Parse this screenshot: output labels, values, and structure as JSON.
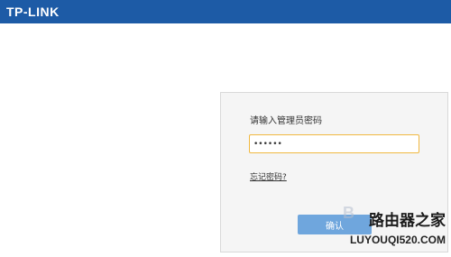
{
  "header": {
    "brand": "TP-LINK",
    "color": "#1d5ba6"
  },
  "login": {
    "prompt": "请输入管理员密码",
    "password_value": "••••••",
    "forgot_link": "忘记密码?",
    "confirm_label": "确认"
  },
  "watermark": {
    "title": "路由器之家",
    "url": "LUYOUQI520.COM"
  }
}
